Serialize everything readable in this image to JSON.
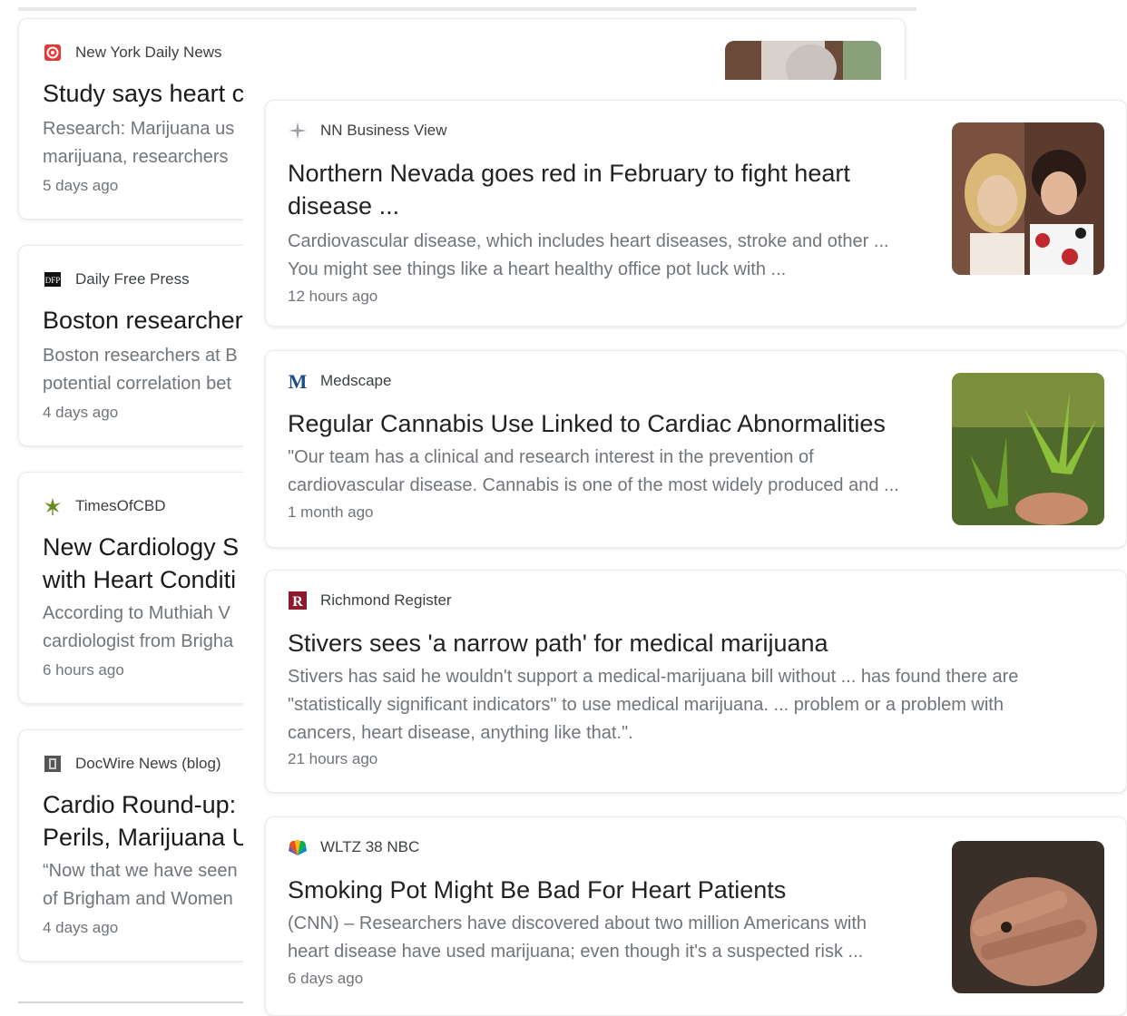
{
  "back_cards": [
    {
      "source": "New York Daily News",
      "title": "Study says heart c",
      "snippet": "Research: Marijuana us\nmarijuana, researchers",
      "time": "5 days ago"
    },
    {
      "source": "Daily Free Press",
      "title": "Boston researcher",
      "snippet": "Boston researchers at B\npotential correlation bet",
      "time": "4 days ago"
    },
    {
      "source": "TimesOfCBD",
      "title": "New Cardiology S\nwith Heart Conditi",
      "snippet": "According to Muthiah V\ncardiologist from Brigha",
      "time": "6 hours ago"
    },
    {
      "source": "DocWire News (blog)",
      "title": "Cardio Round-up:\nPerils, Marijuana U",
      "snippet": "“Now that we have seen\nof Brigham and Women",
      "time": "4 days ago"
    }
  ],
  "front_cards": [
    {
      "source": "NN Business View",
      "title": "Northern Nevada goes red in February to fight heart\ndisease ...",
      "snippet": "Cardiovascular disease, which includes heart diseases, stroke and other ...\nYou might see things like a heart healthy office pot luck with ...",
      "time": "12 hours ago"
    },
    {
      "source": "Medscape",
      "title": "Regular Cannabis Use Linked to Cardiac Abnormalities",
      "snippet": "\"Our team has a clinical and research interest in the prevention of\ncardiovascular disease. Cannabis is one of the most widely produced and ...",
      "time": "1 month ago"
    },
    {
      "source": "Richmond Register",
      "title": "Stivers sees 'a narrow path' for medical marijuana",
      "snippet": "Stivers has said he wouldn't support a medical-marijuana bill without ... has found there are\n\"statistically significant indicators\" to use medical marijuana. ... problem or a problem with\ncancers, heart disease, anything like that.\".",
      "time": "21 hours ago"
    },
    {
      "source": "WLTZ 38 NBC",
      "title": "Smoking Pot Might Be Bad For Heart Patients",
      "snippet": "(CNN) – Researchers have discovered about two million Americans with\nheart disease have used marijuana; even though it's a suspected risk ...",
      "time": "6 days ago"
    }
  ],
  "colors": {
    "nydn_logo": "#e53935",
    "medscape_logo": "#1a4c8c",
    "richmond_logo": "#8b1a2b",
    "timesofcbd_logo": "#6a8a1f"
  },
  "icons": {
    "nydn": "nydn-logo-icon",
    "dfp": "dfp-logo-icon",
    "timesofcbd": "cannabis-leaf-logo-icon",
    "docwire": "docwire-logo-icon",
    "nnbv": "sparkle-logo-icon",
    "medscape": "medscape-m-logo-icon",
    "richmond": "richmond-r-logo-icon",
    "wltz": "nbc-peacock-logo-icon"
  }
}
